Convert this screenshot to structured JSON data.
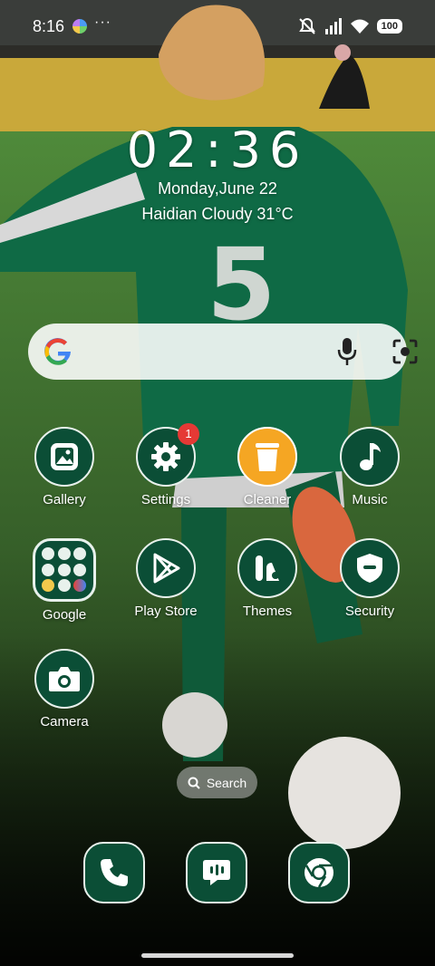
{
  "status_bar": {
    "time": "8:16",
    "more": "···",
    "battery": "100"
  },
  "clock": {
    "time": "02:36",
    "date": "Monday,June 22",
    "weather": "Haidian Cloudy 31°C"
  },
  "jersey_number": "5",
  "apps": [
    {
      "label": "Gallery",
      "icon": "gallery-icon"
    },
    {
      "label": "Settings",
      "icon": "gear-icon",
      "badge": "1"
    },
    {
      "label": "Cleaner",
      "icon": "trash-icon"
    },
    {
      "label": "Music",
      "icon": "music-note-icon"
    },
    {
      "label": "Google",
      "icon": "folder-icon"
    },
    {
      "label": "Play Store",
      "icon": "play-icon"
    },
    {
      "label": "Themes",
      "icon": "themes-icon"
    },
    {
      "label": "Security",
      "icon": "shield-icon"
    },
    {
      "label": "Camera",
      "icon": "camera-icon"
    }
  ],
  "search_pill": {
    "label": "Search"
  },
  "dock": [
    {
      "icon": "phone-icon"
    },
    {
      "icon": "messages-icon"
    },
    {
      "icon": "chrome-icon"
    }
  ]
}
